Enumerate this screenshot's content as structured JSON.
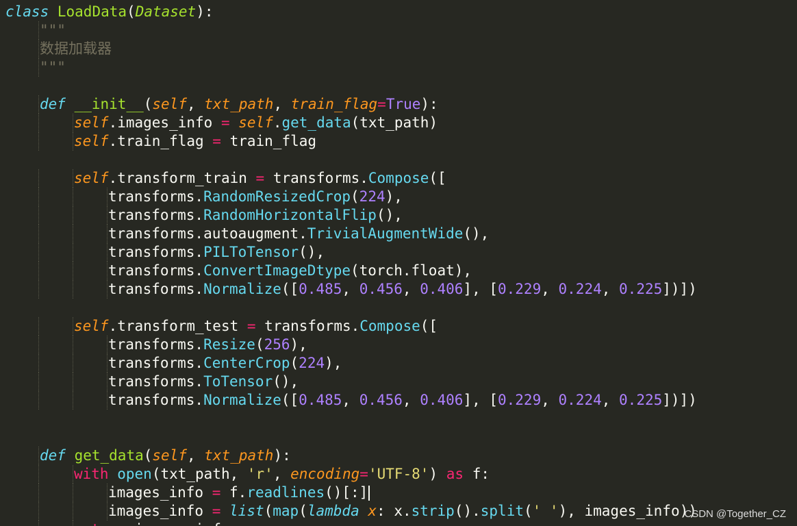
{
  "watermark": "CSDN @Together_CZ",
  "colors": {
    "background": "#272822",
    "default": "#F8F8F2",
    "keyword": "#66D9EF",
    "control_keyword": "#F92672",
    "function_name": "#A6E22E",
    "self_and_params": "#FD971F",
    "method_call": "#66D9EF",
    "number": "#AE81FF",
    "string": "#E6DB74",
    "comment": "#75715E"
  },
  "lines": [
    {
      "indent": 0,
      "tokens": [
        [
          "class",
          "kw-it"
        ],
        [
          " ",
          "plain"
        ],
        [
          "LoadData",
          "cls"
        ],
        [
          "(",
          "plain"
        ],
        [
          "Dataset",
          "base"
        ],
        [
          "):",
          "plain"
        ]
      ]
    },
    {
      "indent": 1,
      "tokens": [
        [
          "\"\"\"",
          "doc"
        ]
      ]
    },
    {
      "indent": 1,
      "tokens": [
        [
          "数据加载器",
          "doccn"
        ]
      ]
    },
    {
      "indent": 1,
      "tokens": [
        [
          "\"\"\"",
          "doc"
        ]
      ]
    },
    {
      "indent": 0,
      "tokens": []
    },
    {
      "indent": 1,
      "tokens": [
        [
          "def",
          "kw-it"
        ],
        [
          " ",
          "plain"
        ],
        [
          "__init__",
          "fn"
        ],
        [
          "(",
          "plain"
        ],
        [
          "self",
          "self"
        ],
        [
          ", ",
          "plain"
        ],
        [
          "txt_path",
          "param"
        ],
        [
          ", ",
          "plain"
        ],
        [
          "train_flag",
          "param"
        ],
        [
          "=",
          "op"
        ],
        [
          "True",
          "const"
        ],
        [
          "):",
          "plain"
        ]
      ]
    },
    {
      "indent": 2,
      "tokens": [
        [
          "self",
          "self"
        ],
        [
          ".images_info ",
          "plain"
        ],
        [
          "=",
          "op"
        ],
        [
          " ",
          "plain"
        ],
        [
          "self",
          "self"
        ],
        [
          ".",
          "plain"
        ],
        [
          "get_data",
          "method"
        ],
        [
          "(txt_path)",
          "plain"
        ]
      ]
    },
    {
      "indent": 2,
      "tokens": [
        [
          "self",
          "self"
        ],
        [
          ".train_flag ",
          "plain"
        ],
        [
          "=",
          "op"
        ],
        [
          " train_flag",
          "plain"
        ]
      ]
    },
    {
      "indent": 0,
      "tokens": []
    },
    {
      "indent": 2,
      "tokens": [
        [
          "self",
          "self"
        ],
        [
          ".transform_train ",
          "plain"
        ],
        [
          "=",
          "op"
        ],
        [
          " transforms.",
          "plain"
        ],
        [
          "Compose",
          "method"
        ],
        [
          "([",
          "plain"
        ]
      ]
    },
    {
      "indent": 3,
      "tokens": [
        [
          "transforms.",
          "plain"
        ],
        [
          "RandomResizedCrop",
          "method"
        ],
        [
          "(",
          "plain"
        ],
        [
          "224",
          "num"
        ],
        [
          "),",
          "plain"
        ]
      ]
    },
    {
      "indent": 3,
      "tokens": [
        [
          "transforms.",
          "plain"
        ],
        [
          "RandomHorizontalFlip",
          "method"
        ],
        [
          "(),",
          "plain"
        ]
      ]
    },
    {
      "indent": 3,
      "tokens": [
        [
          "transforms.autoaugment.",
          "plain"
        ],
        [
          "TrivialAugmentWide",
          "method"
        ],
        [
          "(),",
          "plain"
        ]
      ]
    },
    {
      "indent": 3,
      "tokens": [
        [
          "transforms.",
          "plain"
        ],
        [
          "PILToTensor",
          "method"
        ],
        [
          "(),",
          "plain"
        ]
      ]
    },
    {
      "indent": 3,
      "tokens": [
        [
          "transforms.",
          "plain"
        ],
        [
          "ConvertImageDtype",
          "method"
        ],
        [
          "(torch.float),",
          "plain"
        ]
      ]
    },
    {
      "indent": 3,
      "tokens": [
        [
          "transforms.",
          "plain"
        ],
        [
          "Normalize",
          "method"
        ],
        [
          "([",
          "plain"
        ],
        [
          "0.485",
          "num"
        ],
        [
          ", ",
          "plain"
        ],
        [
          "0.456",
          "num"
        ],
        [
          ", ",
          "plain"
        ],
        [
          "0.406",
          "num"
        ],
        [
          "], [",
          "plain"
        ],
        [
          "0.229",
          "num"
        ],
        [
          ", ",
          "plain"
        ],
        [
          "0.224",
          "num"
        ],
        [
          ", ",
          "plain"
        ],
        [
          "0.225",
          "num"
        ],
        [
          "])])",
          "plain"
        ]
      ]
    },
    {
      "indent": 0,
      "tokens": []
    },
    {
      "indent": 2,
      "tokens": [
        [
          "self",
          "self"
        ],
        [
          ".transform_test ",
          "plain"
        ],
        [
          "=",
          "op"
        ],
        [
          " transforms.",
          "plain"
        ],
        [
          "Compose",
          "method"
        ],
        [
          "([",
          "plain"
        ]
      ]
    },
    {
      "indent": 3,
      "tokens": [
        [
          "transforms.",
          "plain"
        ],
        [
          "Resize",
          "method"
        ],
        [
          "(",
          "plain"
        ],
        [
          "256",
          "num"
        ],
        [
          "),",
          "plain"
        ]
      ]
    },
    {
      "indent": 3,
      "tokens": [
        [
          "transforms.",
          "plain"
        ],
        [
          "CenterCrop",
          "method"
        ],
        [
          "(",
          "plain"
        ],
        [
          "224",
          "num"
        ],
        [
          "),",
          "plain"
        ]
      ]
    },
    {
      "indent": 3,
      "tokens": [
        [
          "transforms.",
          "plain"
        ],
        [
          "ToTensor",
          "method"
        ],
        [
          "(),",
          "plain"
        ]
      ]
    },
    {
      "indent": 3,
      "tokens": [
        [
          "transforms.",
          "plain"
        ],
        [
          "Normalize",
          "method"
        ],
        [
          "([",
          "plain"
        ],
        [
          "0.485",
          "num"
        ],
        [
          ", ",
          "plain"
        ],
        [
          "0.456",
          "num"
        ],
        [
          ", ",
          "plain"
        ],
        [
          "0.406",
          "num"
        ],
        [
          "], [",
          "plain"
        ],
        [
          "0.229",
          "num"
        ],
        [
          ", ",
          "plain"
        ],
        [
          "0.224",
          "num"
        ],
        [
          ", ",
          "plain"
        ],
        [
          "0.225",
          "num"
        ],
        [
          "])])",
          "plain"
        ]
      ]
    },
    {
      "indent": 0,
      "tokens": []
    },
    {
      "indent": 0,
      "tokens": []
    },
    {
      "indent": 1,
      "tokens": [
        [
          "def",
          "kw-it"
        ],
        [
          " ",
          "plain"
        ],
        [
          "get_data",
          "fn"
        ],
        [
          "(",
          "plain"
        ],
        [
          "self",
          "self"
        ],
        [
          ", ",
          "plain"
        ],
        [
          "txt_path",
          "param"
        ],
        [
          "):",
          "plain"
        ]
      ]
    },
    {
      "indent": 2,
      "tokens": [
        [
          "with",
          "kw"
        ],
        [
          " ",
          "plain"
        ],
        [
          "open",
          "method"
        ],
        [
          "(txt_path, ",
          "plain"
        ],
        [
          "'r'",
          "str"
        ],
        [
          ", ",
          "plain"
        ],
        [
          "encoding",
          "param"
        ],
        [
          "=",
          "op"
        ],
        [
          "'UTF-8'",
          "str"
        ],
        [
          ") ",
          "plain"
        ],
        [
          "as",
          "kw"
        ],
        [
          " f:",
          "plain"
        ]
      ]
    },
    {
      "indent": 3,
      "cursor": true,
      "tokens": [
        [
          "images_info ",
          "plain"
        ],
        [
          "=",
          "op"
        ],
        [
          " f.",
          "plain"
        ],
        [
          "readlines",
          "method"
        ],
        [
          "()[:]",
          "plain"
        ]
      ]
    },
    {
      "indent": 3,
      "tokens": [
        [
          "images_info ",
          "plain"
        ],
        [
          "=",
          "op"
        ],
        [
          " ",
          "plain"
        ],
        [
          "list",
          "kw-it"
        ],
        [
          "(",
          "plain"
        ],
        [
          "map",
          "method"
        ],
        [
          "(",
          "plain"
        ],
        [
          "lambda",
          "kw-it"
        ],
        [
          " ",
          "plain"
        ],
        [
          "x",
          "param"
        ],
        [
          ": x.",
          "plain"
        ],
        [
          "strip",
          "method"
        ],
        [
          "().",
          "plain"
        ],
        [
          "split",
          "method"
        ],
        [
          "(",
          "plain"
        ],
        [
          "' '",
          "str"
        ],
        [
          "), images_info))",
          "plain"
        ]
      ]
    },
    {
      "indent": 2,
      "tokens": [
        [
          "return",
          "kw"
        ],
        [
          " images_info",
          "plain"
        ]
      ]
    }
  ]
}
